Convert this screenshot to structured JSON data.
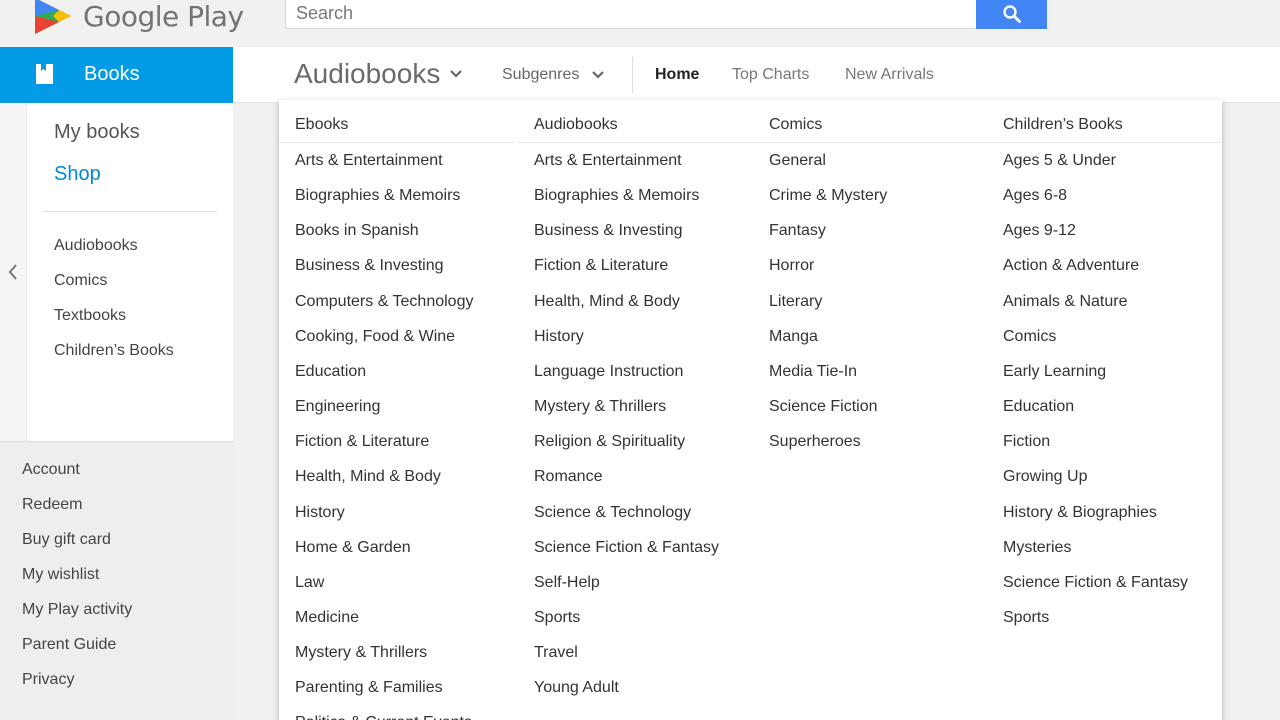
{
  "header": {
    "logo_text": "Google Play",
    "search_placeholder": "Search"
  },
  "sidebar": {
    "section_label": "Books",
    "my_books": "My books",
    "shop": "Shop",
    "categories": [
      "Audiobooks",
      "Comics",
      "Textbooks",
      "Children’s Books"
    ],
    "footer": [
      "Account",
      "Redeem",
      "Buy gift card",
      "My wishlist",
      "My Play activity",
      "Parent Guide",
      "Privacy"
    ]
  },
  "nav": {
    "category": "Audiobooks",
    "subgenres": "Subgenres",
    "links": [
      "Home",
      "Top Charts",
      "New Arrivals"
    ],
    "active": "Home"
  },
  "dropdown": {
    "columns": [
      {
        "heading": "Ebooks",
        "items": [
          "Arts & Entertainment",
          "Biographies & Memoirs",
          "Books in Spanish",
          "Business & Investing",
          "Computers & Technology",
          "Cooking, Food & Wine",
          "Education",
          "Engineering",
          "Fiction & Literature",
          "Health, Mind & Body",
          "History",
          "Home & Garden",
          "Law",
          "Medicine",
          "Mystery & Thrillers",
          "Parenting & Families",
          "Politics & Current Events"
        ]
      },
      {
        "heading": "Audiobooks",
        "items": [
          "Arts & Entertainment",
          "Biographies & Memoirs",
          "Business & Investing",
          "Fiction & Literature",
          "Health, Mind & Body",
          "History",
          "Language Instruction",
          "Mystery & Thrillers",
          "Religion & Spirituality",
          "Romance",
          "Science & Technology",
          "Science Fiction & Fantasy",
          "Self-Help",
          "Sports",
          "Travel",
          "Young Adult"
        ]
      },
      {
        "heading": "Comics",
        "items": [
          "General",
          "Crime & Mystery",
          "Fantasy",
          "Horror",
          "Literary",
          "Manga",
          "Media Tie-In",
          "Science Fiction",
          "Superheroes"
        ]
      },
      {
        "heading": "Children’s Books",
        "items": [
          "Ages 5 & Under",
          "Ages 6-8",
          "Ages 9-12",
          "Action & Adventure",
          "Animals & Nature",
          "Comics",
          "Early Learning",
          "Education",
          "Fiction",
          "Growing Up",
          "History & Biographies",
          "Mysteries",
          "Science Fiction & Fantasy",
          "Sports"
        ]
      }
    ]
  },
  "colors": {
    "accent": "#039be5",
    "search_button": "#4285f4",
    "shop_link": "#0288d1"
  }
}
